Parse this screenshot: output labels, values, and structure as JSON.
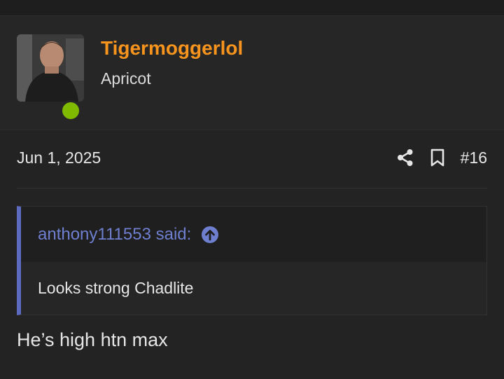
{
  "user": {
    "username": "Tigermoggerlol",
    "title": "Apricot",
    "status_color": "#7fba00",
    "username_color": "#f7941d"
  },
  "post": {
    "date": "Jun 1, 2025",
    "number": "#16",
    "actions": [
      {
        "name": "share",
        "icon": "share-icon"
      },
      {
        "name": "bookmark",
        "icon": "bookmark-icon"
      }
    ],
    "quote": {
      "author_line": "anthony111553 said:",
      "text": "Looks strong Chadlite",
      "accent_color": "#5c6bc0"
    },
    "message": "He’s high htn max"
  }
}
